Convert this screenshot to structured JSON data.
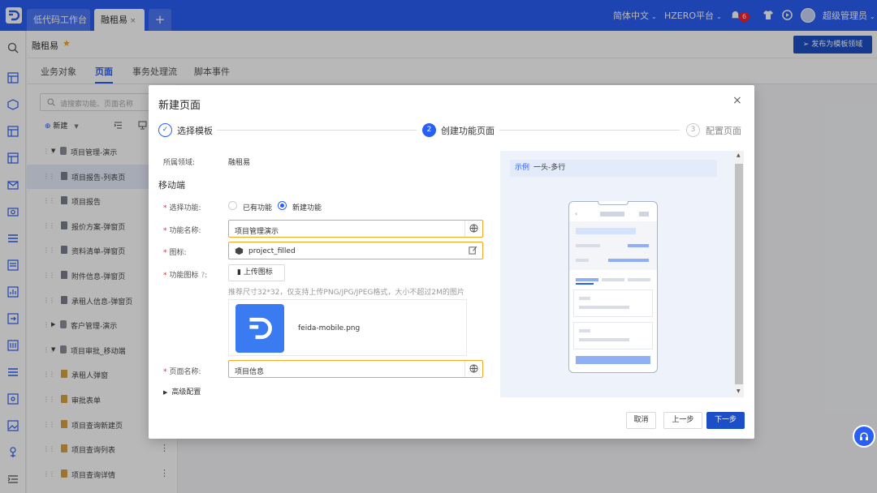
{
  "topbar": {
    "tabs": [
      "低代码工作台",
      "融租易"
    ],
    "tab_close": "×",
    "add_tab": "+",
    "language": "简体中文",
    "platform": "HZERO平台",
    "notification_count": "6",
    "user": "超级管理员"
  },
  "page": {
    "title": "融租易",
    "publish_button": "发布为模板领域",
    "subtabs": [
      "业务对象",
      "页面",
      "事务处理流",
      "脚本事件"
    ],
    "active_subtab": "页面"
  },
  "tree": {
    "search_placeholder": "请搜索功能、页面名称",
    "new_label": "新建",
    "items": [
      {
        "label": "项目管理-演示",
        "level": 0,
        "selected": false
      },
      {
        "label": "项目报告-列表页",
        "level": 1,
        "selected": true
      },
      {
        "label": "项目报告",
        "level": 1,
        "selected": false
      },
      {
        "label": "报价方案-弹窗页",
        "level": 1,
        "selected": false
      },
      {
        "label": "资料清单-弹窗页",
        "level": 1,
        "selected": false
      },
      {
        "label": "附件信息-弹窗页",
        "level": 1,
        "selected": false
      },
      {
        "label": "承租人信息-弹窗页",
        "level": 1,
        "selected": false
      },
      {
        "label": "客户管理-演示",
        "level": 0,
        "selected": false
      },
      {
        "label": "项目审批_移动端",
        "level": 0,
        "selected": false
      },
      {
        "label": "承租人弹窗",
        "level": 1,
        "selected": false
      },
      {
        "label": "审批表单",
        "level": 1,
        "selected": false
      },
      {
        "label": "项目查询新建页",
        "level": 1,
        "selected": false
      },
      {
        "label": "项目查询列表",
        "level": 1,
        "selected": false
      },
      {
        "label": "项目查询详情",
        "level": 1,
        "selected": false
      }
    ]
  },
  "modal": {
    "title": "新建页面",
    "close": "×",
    "steps": [
      {
        "index": "1",
        "label": "选择模板",
        "state": "done"
      },
      {
        "index": "2",
        "label": "创建功能页面",
        "state": "active"
      },
      {
        "index": "3",
        "label": "配置页面",
        "state": "pending"
      }
    ],
    "domain_label": "所属领域:",
    "domain_value": "融租易",
    "section_title": "移动端",
    "select_function_label": "选择功能:",
    "radio_existing": "已有功能",
    "radio_new": "新建功能",
    "function_name_label": "功能名称:",
    "function_name_value": "项目管理演示",
    "icon_label": "图标:",
    "icon_value": "project_filled",
    "function_icon_label": "功能图标",
    "upload_button": "上传图标",
    "upload_hint": "推荐尺寸32*32，仅支持上传PNG/JPG/JPEG格式，大小不超过2M的图片",
    "file_name": "feida-mobile.png",
    "page_name_label": "页面名称:",
    "page_name_value": "项目信息",
    "advanced": "高级配置",
    "preview_tag": "示例",
    "preview_name": "一头-多行",
    "buttons": {
      "cancel": "取消",
      "prev": "上一步",
      "next": "下一步"
    }
  },
  "colors": {
    "primary": "#2a5ff5",
    "dark_primary": "#1c4fc7",
    "warning_border": "#f5a623",
    "required": "#f5222d"
  }
}
